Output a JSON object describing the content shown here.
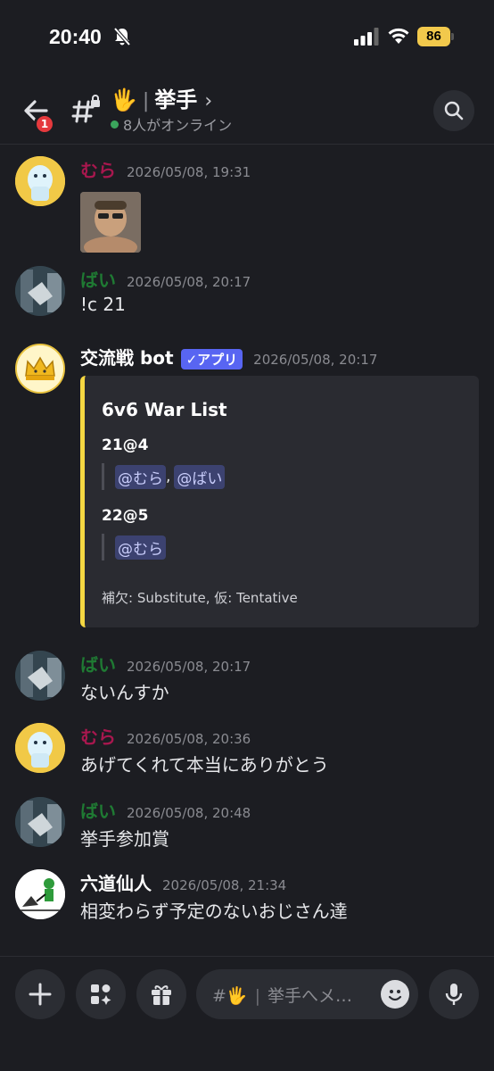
{
  "status_bar": {
    "time": "20:40",
    "battery": "86",
    "icons": [
      "bell-off-icon",
      "signal-icon",
      "wifi-icon",
      "battery-icon"
    ]
  },
  "header": {
    "unread_badge": "1",
    "channel_emoji": "🖐",
    "channel_name": "挙手",
    "separator": "|",
    "chevron": "›",
    "online_text": "8人がオンライン"
  },
  "messages": [
    {
      "user": "むら",
      "user_color": "#a8174e",
      "timestamp": "2026/05/08, 19:31",
      "text": "",
      "attachment": "photo"
    },
    {
      "user": "ばい",
      "user_color": "#1f7a33",
      "timestamp": "2026/05/08, 20:17",
      "text": "!c 21"
    },
    {
      "user": "交流戦 bot",
      "user_color": "#ffffff",
      "badge": "✓アプリ",
      "timestamp": "2026/05/08, 20:17",
      "text": ""
    },
    {
      "user": "ばい",
      "user_color": "#1f7a33",
      "timestamp": "2026/05/08, 20:17",
      "text": "ないんすか"
    },
    {
      "user": "むら",
      "user_color": "#a8174e",
      "timestamp": "2026/05/08, 20:36",
      "text": "あげてくれて本当にありがとう"
    },
    {
      "user": "ばい",
      "user_color": "#1f7a33",
      "timestamp": "2026/05/08, 20:48",
      "text": "挙手参加賞"
    },
    {
      "user": "六道仙人",
      "user_color": "#ffffff",
      "timestamp": "2026/05/08, 21:34",
      "text": "相変わらず予定のないおじさん達"
    }
  ],
  "embed": {
    "title": "6v6 War List",
    "accent_color": "#f5d742",
    "fields": [
      {
        "name": "21@4",
        "mentions": [
          "@むら",
          "@ばい"
        ]
      },
      {
        "name": "22@5",
        "mentions": [
          "@むら"
        ]
      }
    ],
    "footer": "補欠: Substitute, 仮: Tentative"
  },
  "input": {
    "channel_prefix": "#🖐",
    "placeholder": "挙手へメ…",
    "buttons": [
      "plus-icon",
      "apps-icon",
      "gift-icon",
      "emoji-icon",
      "mic-icon"
    ]
  }
}
